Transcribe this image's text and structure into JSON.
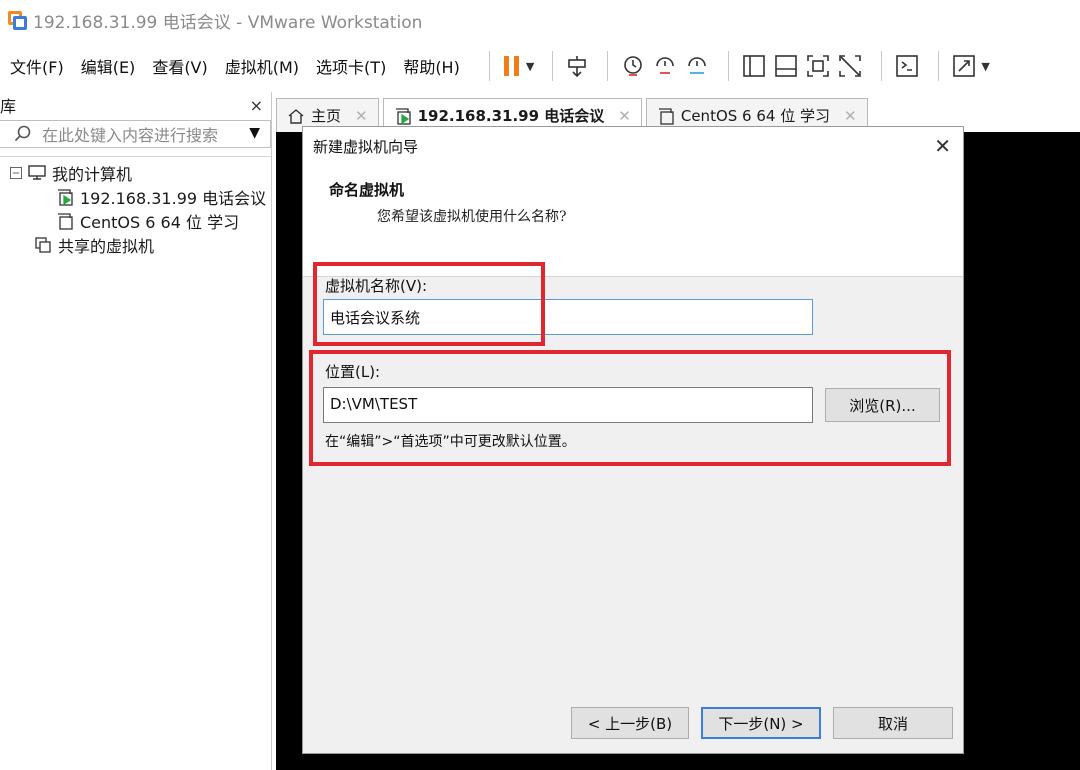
{
  "window": {
    "title": "192.168.31.99 电话会议 - VMware Workstation"
  },
  "menu": {
    "items": [
      "文件(F)",
      "编辑(E)",
      "查看(V)",
      "虚拟机(M)",
      "选项卡(T)",
      "帮助(H)"
    ],
    "toolbar_icons": [
      "pause-icon",
      "send-keys-icon",
      "snapshot-icon",
      "revert-snapshot-icon",
      "manage-snapshots-icon",
      "library-view-icon",
      "thumbnail-bar-icon",
      "fullscreen-icon",
      "unity-icon",
      "console-icon",
      "stretch-icon"
    ]
  },
  "library": {
    "title": "库",
    "close": "×",
    "search_placeholder": "在此处键入内容进行搜索",
    "tree": {
      "root": "我的计算机",
      "vms": [
        "192.168.31.99 电话会议",
        "CentOS 6 64 位 学习"
      ],
      "shared": "共享的虚拟机"
    }
  },
  "tabs": [
    {
      "label": "主页",
      "icon": "home-icon"
    },
    {
      "label": "192.168.31.99 电话会议",
      "icon": "vm-running-icon",
      "active": true
    },
    {
      "label": "CentOS 6 64 位 学习",
      "icon": "vm-icon"
    }
  ],
  "dialog": {
    "title": "新建虚拟机向导",
    "heading": "命名虚拟机",
    "subheading": "您希望该虚拟机使用什么名称?",
    "name_label": "虚拟机名称(V):",
    "name_value": "电话会议系统",
    "location_label": "位置(L):",
    "location_value": "D:\\VM\\TEST",
    "browse_button": "浏览(R)...",
    "hint": "在“编辑”>“首选项”中可更改默认位置。",
    "back_button": "< 上一步(B)",
    "next_button": "下一步(N) >",
    "cancel_button": "取消"
  },
  "colors": {
    "highlight": "#e0262e",
    "accent": "#3c7fd8",
    "pause": "#f07d1a"
  }
}
